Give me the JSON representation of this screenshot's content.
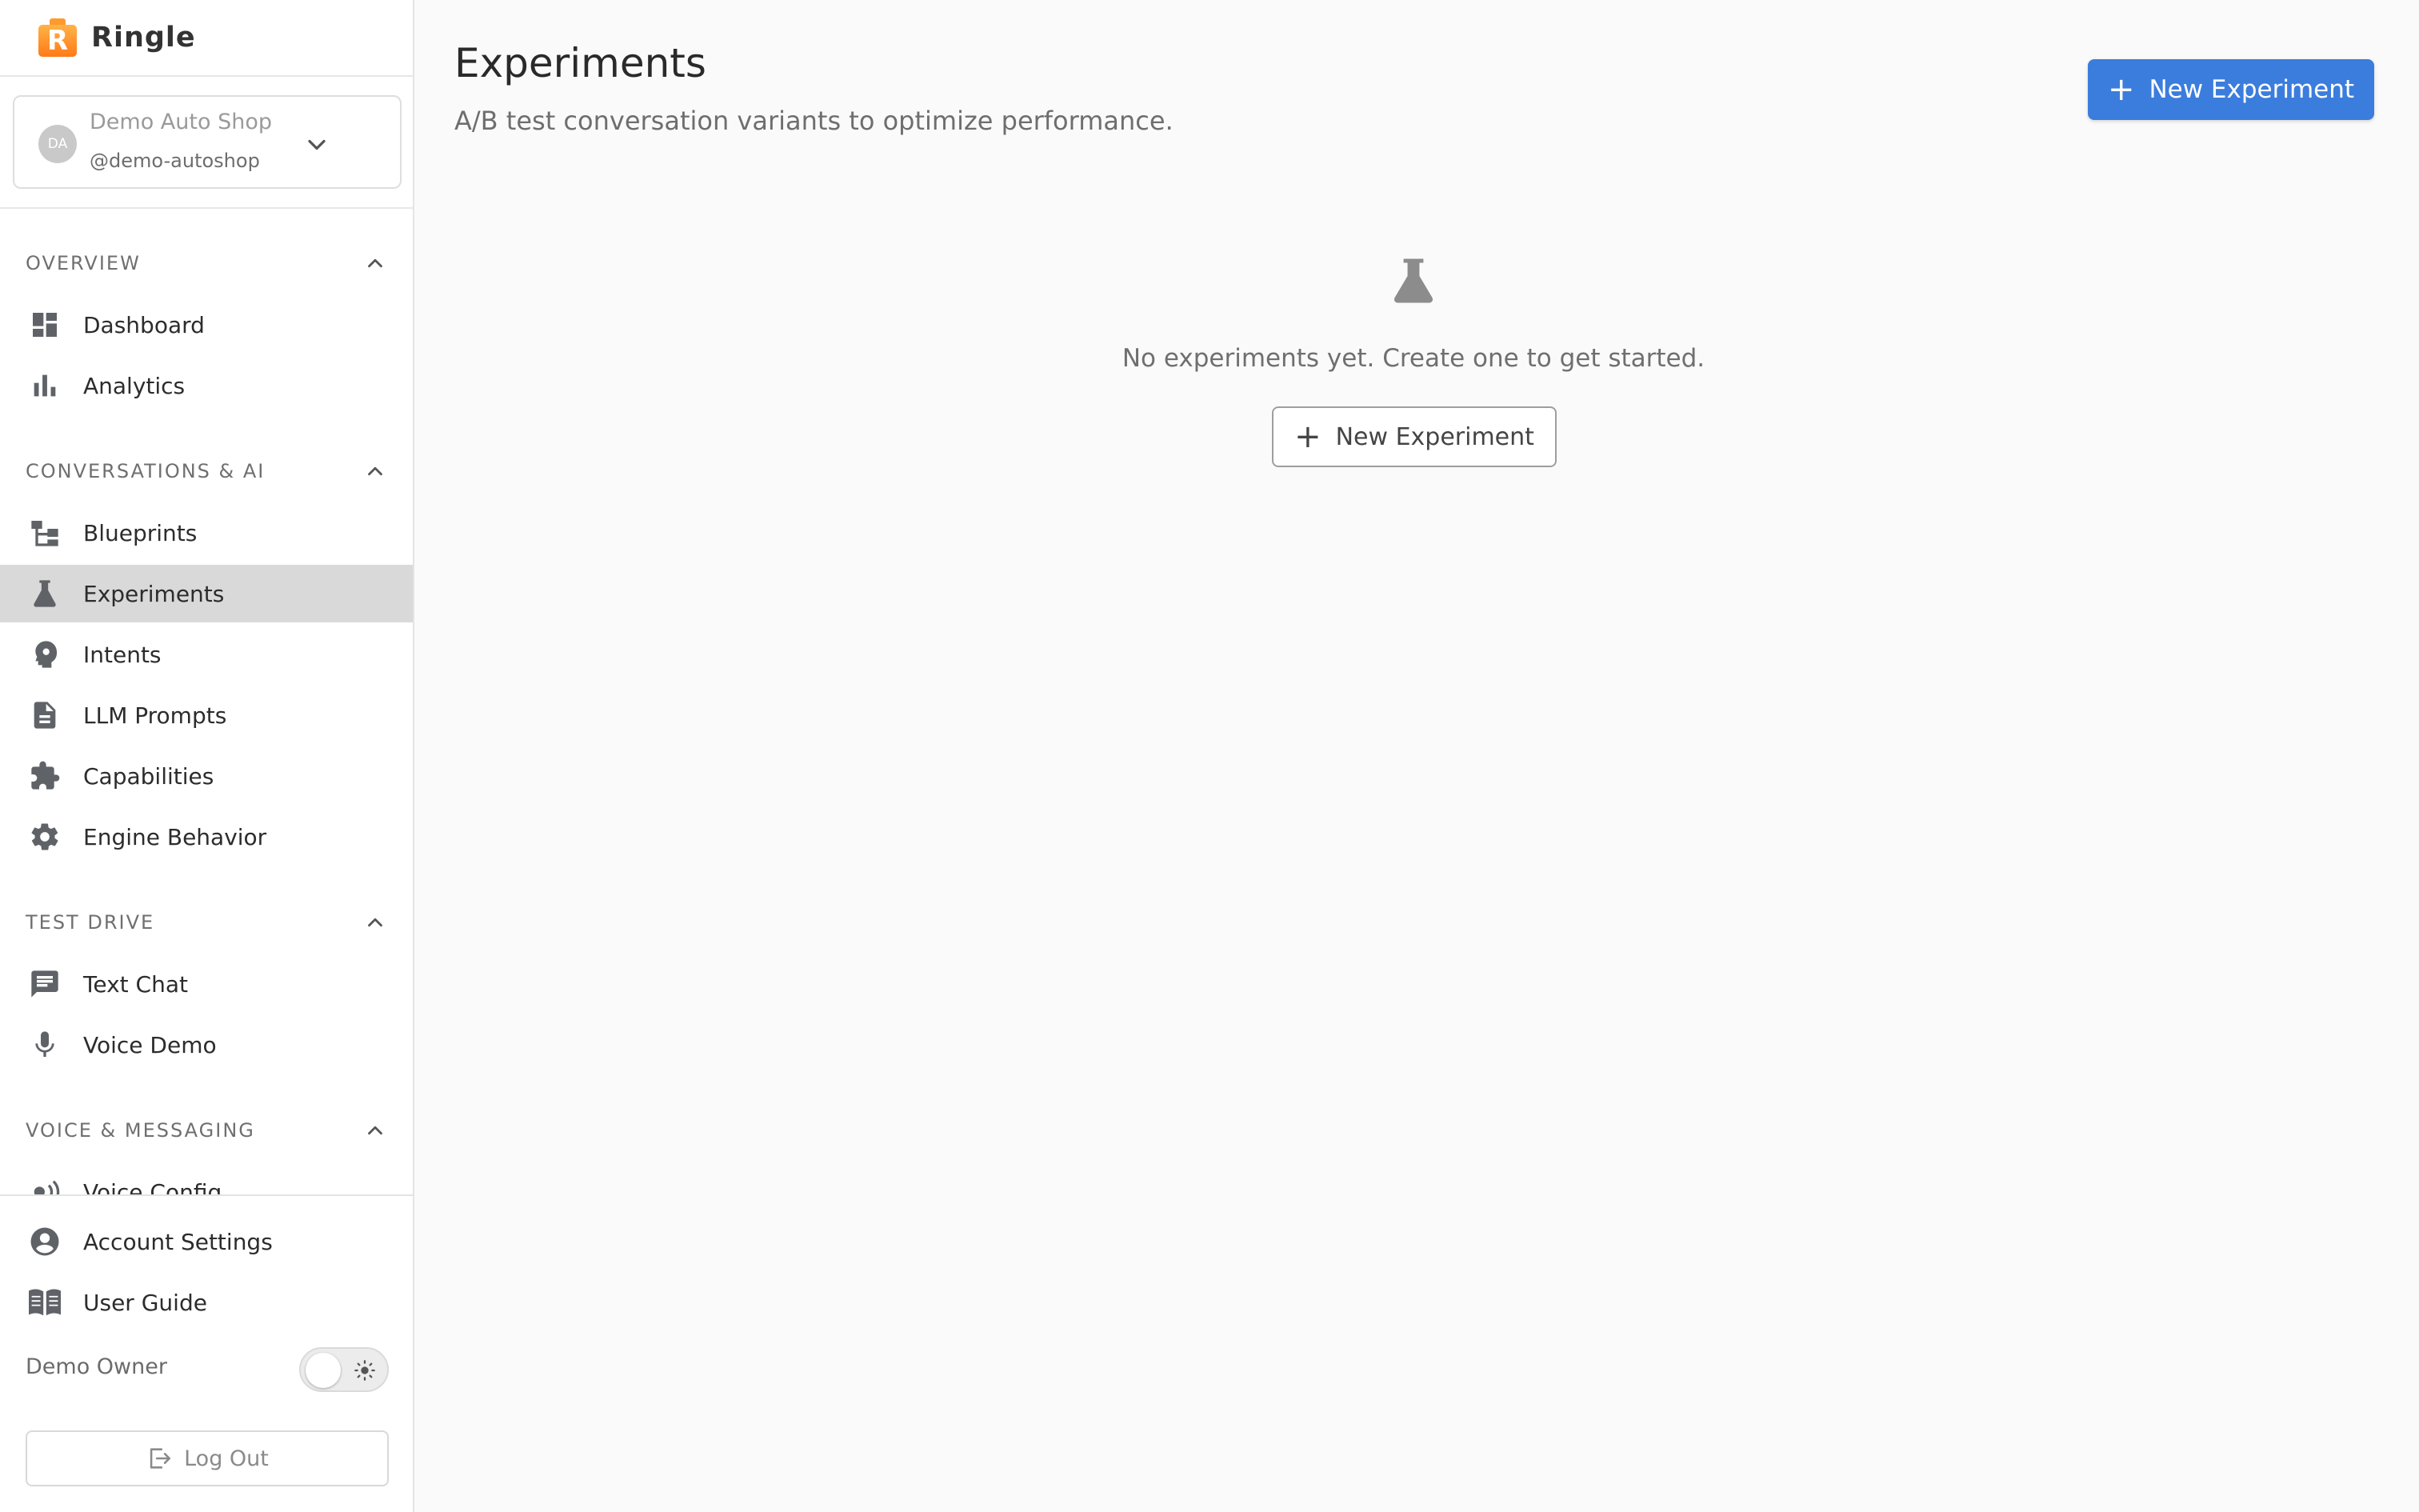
{
  "brand": {
    "name": "Ringle",
    "logo_letter": "R"
  },
  "account": {
    "initials": "DA",
    "name": "Demo Auto Shop",
    "handle": "@demo-autoshop"
  },
  "sidebar": {
    "sections": [
      {
        "label": "OVERVIEW",
        "items": [
          {
            "label": "Dashboard",
            "icon": "dashboard-icon"
          },
          {
            "label": "Analytics",
            "icon": "bar-chart-icon"
          }
        ]
      },
      {
        "label": "CONVERSATIONS & AI",
        "items": [
          {
            "label": "Blueprints",
            "icon": "blueprint-tree-icon"
          },
          {
            "label": "Experiments",
            "icon": "flask-icon",
            "active": true
          },
          {
            "label": "Intents",
            "icon": "head-gear-icon"
          },
          {
            "label": "LLM Prompts",
            "icon": "document-icon"
          },
          {
            "label": "Capabilities",
            "icon": "puzzle-icon"
          },
          {
            "label": "Engine Behavior",
            "icon": "gear-icon"
          }
        ]
      },
      {
        "label": "TEST DRIVE",
        "items": [
          {
            "label": "Text Chat",
            "icon": "chat-icon"
          },
          {
            "label": "Voice Demo",
            "icon": "microphone-icon"
          }
        ]
      },
      {
        "label": "VOICE & MESSAGING",
        "items": [
          {
            "label": "Voice Config",
            "icon": "voice-waves-icon"
          }
        ]
      }
    ],
    "footer": {
      "account_settings": "Account Settings",
      "user_guide": "User Guide",
      "user_name": "Demo Owner",
      "logout": "Log Out"
    }
  },
  "main": {
    "title": "Experiments",
    "subtitle": "A/B test conversation variants to optimize performance.",
    "primary_button": "New Experiment",
    "empty_state": {
      "message": "No experiments yet. Create one to get started.",
      "button": "New Experiment"
    }
  },
  "colors": {
    "accent": "#3b7ddd",
    "active_nav_bg": "#d9d9d9",
    "brand_orange": "#ff7a18"
  }
}
